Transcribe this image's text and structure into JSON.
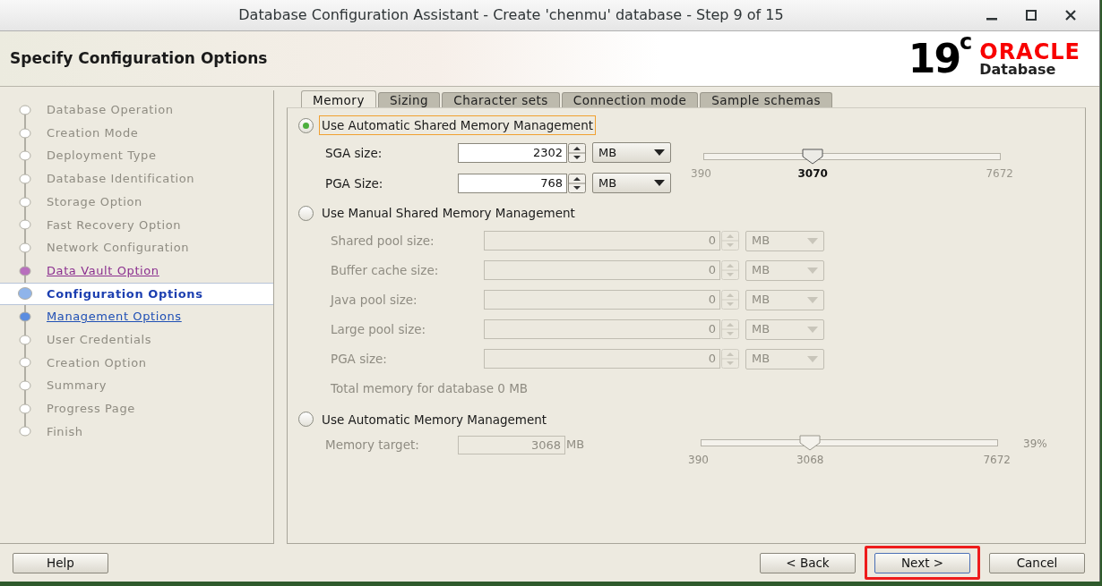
{
  "window": {
    "title": "Database Configuration Assistant - Create 'chenmu' database - Step 9 of 15"
  },
  "header": {
    "title": "Specify Configuration Options",
    "logo": {
      "version": "19",
      "superscript": "c",
      "brand": "ORACLE",
      "product": "Database"
    }
  },
  "steps": [
    {
      "label": "Database Operation",
      "disabled": true,
      "visited": false,
      "selected": false
    },
    {
      "label": "Creation Mode",
      "disabled": true,
      "visited": false,
      "selected": false
    },
    {
      "label": "Deployment Type",
      "disabled": true,
      "visited": false,
      "selected": false
    },
    {
      "label": "Database Identification",
      "disabled": true,
      "visited": false,
      "selected": false
    },
    {
      "label": "Storage Option",
      "disabled": true,
      "visited": false,
      "selected": false
    },
    {
      "label": "Fast Recovery Option",
      "disabled": true,
      "visited": false,
      "selected": false
    },
    {
      "label": "Network Configuration",
      "disabled": true,
      "visited": false,
      "selected": false
    },
    {
      "label": "Data Vault Option",
      "disabled": false,
      "visited": true,
      "selected": false
    },
    {
      "label": "Configuration Options",
      "disabled": false,
      "visited": false,
      "selected": true
    },
    {
      "label": "Management Options",
      "disabled": false,
      "visited": false,
      "selected": false
    },
    {
      "label": "User Credentials",
      "disabled": true,
      "visited": false,
      "selected": false
    },
    {
      "label": "Creation Option",
      "disabled": true,
      "visited": false,
      "selected": false
    },
    {
      "label": "Summary",
      "disabled": true,
      "visited": false,
      "selected": false
    },
    {
      "label": "Progress Page",
      "disabled": true,
      "visited": false,
      "selected": false
    },
    {
      "label": "Finish",
      "disabled": true,
      "visited": false,
      "selected": false
    }
  ],
  "tabs": [
    {
      "label": "Memory",
      "selected": true
    },
    {
      "label": "Sizing",
      "selected": false
    },
    {
      "label": "Character sets",
      "selected": false
    },
    {
      "label": "Connection mode",
      "selected": false
    },
    {
      "label": "Sample schemas",
      "selected": false
    }
  ],
  "asmm": {
    "label": "Use Automatic Shared Memory Management",
    "selected": true,
    "focused": true,
    "fields": [
      {
        "label": "SGA size:",
        "value": "2302",
        "unit": "MB",
        "disabled": false
      },
      {
        "label": "PGA Size:",
        "value": "768",
        "unit": "MB",
        "disabled": false
      }
    ],
    "slider": {
      "min": "390",
      "value": "3070",
      "max": "7672",
      "level": 0.368,
      "disabled": false
    }
  },
  "manual": {
    "label": "Use Manual Shared Memory Management",
    "selected": false,
    "focused": false,
    "fields": [
      {
        "label": "Shared pool size:",
        "value": "0",
        "unit": "MB",
        "disabled": true
      },
      {
        "label": "Buffer cache size:",
        "value": "0",
        "unit": "MB",
        "disabled": true
      },
      {
        "label": "Java pool size:",
        "value": "0",
        "unit": "MB",
        "disabled": true
      },
      {
        "label": "Large pool size:",
        "value": "0",
        "unit": "MB",
        "disabled": true
      },
      {
        "label": "PGA size:",
        "value": "0",
        "unit": "MB",
        "disabled": true
      }
    ],
    "total": "Total memory for database 0 MB"
  },
  "amm": {
    "label": "Use Automatic Memory Management",
    "selected": false,
    "focused": false,
    "field": {
      "label": "Memory target:",
      "value": "3068",
      "unit": "MB",
      "disabled": true
    },
    "slider": {
      "min": "390",
      "value": "3068",
      "max": "7672",
      "level": 0.368,
      "disabled": true,
      "percent": "39%"
    }
  },
  "footer": {
    "left": [
      {
        "label": "Help",
        "default": false,
        "highlighted": false
      }
    ],
    "right": [
      {
        "label": "< Back",
        "default": false,
        "highlighted": false
      },
      {
        "label": "Next >",
        "default": true,
        "highlighted": true
      },
      {
        "label": "Cancel",
        "default": false,
        "highlighted": false
      }
    ]
  }
}
